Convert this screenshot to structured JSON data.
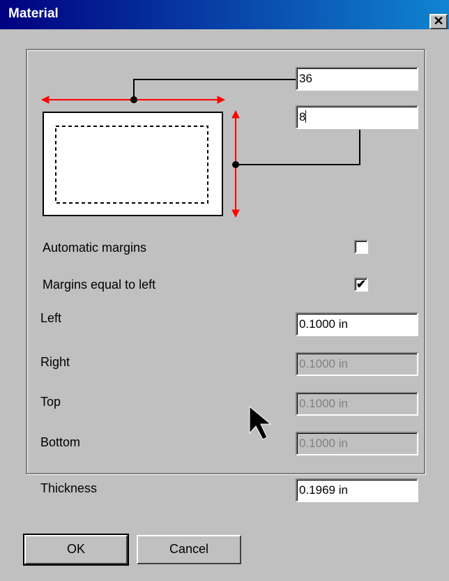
{
  "window": {
    "title": "Material",
    "close_glyph": "✕"
  },
  "dimensions": {
    "width_value": "36",
    "height_value": "8"
  },
  "margins": {
    "automatic_label": "Automatic margins",
    "automatic_checked": false,
    "equal_label": "Margins equal to left",
    "equal_checked": true,
    "left_label": "Left",
    "left_value": "0.1000 in",
    "right_label": "Right",
    "right_value": "0.1000 in",
    "top_label": "Top",
    "top_value": "0.1000 in",
    "bottom_label": "Bottom",
    "bottom_value": "0.1000 in"
  },
  "thickness": {
    "label": "Thickness",
    "value": "0.1969 in"
  },
  "buttons": {
    "ok": "OK",
    "cancel": "Cancel"
  },
  "check_glyph": "✔",
  "colors": {
    "dimension_arrow": "#ff0000",
    "title_start": "#000080",
    "title_end": "#1084d0"
  }
}
